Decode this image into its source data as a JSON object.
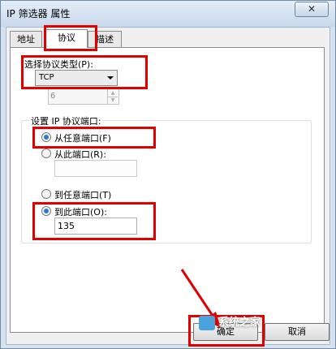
{
  "window": {
    "title": "IP 筛选器 属性",
    "close_glyph": "✕"
  },
  "tabs": [
    {
      "label": "地址"
    },
    {
      "label": "协议"
    },
    {
      "label": "描述"
    }
  ],
  "protocol": {
    "type_label": "选择协议类型(P):",
    "type_value": "TCP",
    "number_value": "6"
  },
  "ports": {
    "group_title": "设置 IP 协议端口:",
    "from_any": "从任意端口(F)",
    "from_this": "从此端口(R):",
    "from_this_value": "",
    "to_any": "到任意端口(T)",
    "to_this": "到此端口(O):",
    "to_this_value": "135"
  },
  "buttons": {
    "ok": "确定",
    "cancel": "取消"
  },
  "watermark": {
    "text": "系统之家"
  },
  "colors": {
    "highlight": "#e00000",
    "radio_dot": "#2a7cc9"
  }
}
